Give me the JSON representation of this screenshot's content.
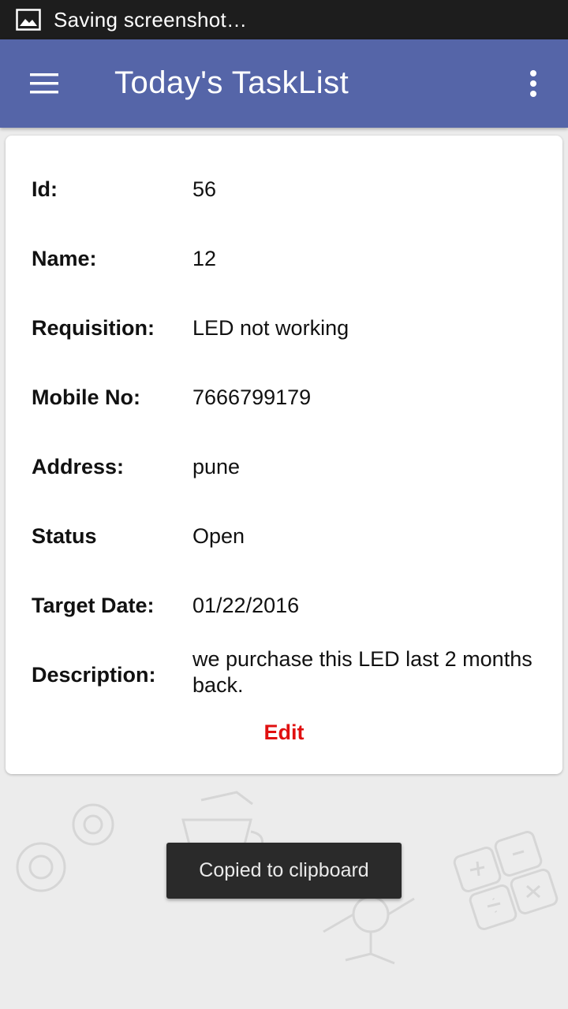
{
  "status_bar": {
    "text": "Saving screenshot…",
    "icon": "image-icon"
  },
  "app_bar": {
    "title": "Today's TaskList",
    "menu_icon": "hamburger-menu-icon",
    "overflow_icon": "more-vert-icon",
    "color": "#5565a8"
  },
  "task": {
    "fields": [
      {
        "label": "Id:",
        "value": "56"
      },
      {
        "label": "Name:",
        "value": "12"
      },
      {
        "label": "Requisition:",
        "value": "LED not working"
      },
      {
        "label": "Mobile No:",
        "value": "7666799179"
      },
      {
        "label": "Address:",
        "value": "pune"
      },
      {
        "label": "Status",
        "value": "Open"
      },
      {
        "label": "Target Date:",
        "value": "01/22/2016"
      },
      {
        "label": "Description:",
        "value": "we purchase this LED last 2 months back."
      }
    ],
    "edit_label": "Edit",
    "edit_color": "#e01010"
  },
  "toast": {
    "text": "Copied to clipboard"
  }
}
